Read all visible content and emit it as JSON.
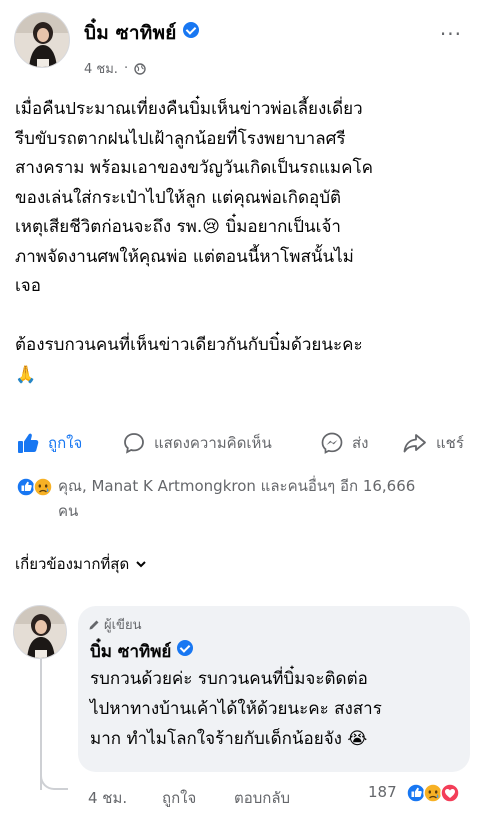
{
  "post": {
    "author": "บิ๋ม ซาทิพย์",
    "time": "4 ชม.",
    "separator": "·",
    "text": "เมื่อคืนประมาณเที่ยงคืนบิ๋มเห็นข่าวพ่อเลี้ยงเดี่ยว\nรีบขับรถตากฝนไปเฝ้าลูกน้อยที่โรงพยาบาลศรี\nสางคราม พร้อมเอาของขวัญวันเกิดเป็นรถแมคโค\nของเล่นใส่กระเป๋าไปให้ลูก แต่คุณพ่อเกิดอุบัติ\nเหตุเสียชีวิตก่อนจะถึง รพ.😢 บิ๋มอยากเป็นเจ้า\nภาพจัดงานศพให้คุณพ่อ แต่ตอนนี้หาโพสนั้นไม่\nเจอ\n\nต้องรบกวนคนที่เห็นข่าวเดียวกันกับบิ๋มด้วยนะคะ\n🙏"
  },
  "actions": {
    "like": "ถูกใจ",
    "comment": "แสดงความคิดเห็น",
    "send": "ส่ง",
    "share": "แชร์"
  },
  "reactions": {
    "summary": "คุณ, Manat K Artmongkron และคนอื่นๆ อีก 16,666\nคน",
    "types": [
      "like",
      "sad"
    ]
  },
  "comments": {
    "sort_label": "เกี่ยวข้องมากที่สุด",
    "items": [
      {
        "badge": "ผู้เขียน",
        "author": "บิ๋ม ซาทิพย์",
        "text": "รบกวนด้วยค่ะ รบกวนคนที่บิ๋มจะติดต่อ\nไปหาทางบ้านเค้าได้ให้ด้วยนะคะ สงสาร\nมาก ทำไมโลกใจร้ายกับเด็กน้อยจัง 😭",
        "time": "4 ชม.",
        "like_label": "ถูกใจ",
        "reply_label": "ตอบกลับ",
        "reaction_count": "187",
        "reaction_types": [
          "like",
          "sad",
          "love"
        ]
      }
    ]
  },
  "icons": {
    "more": "more-icon",
    "globe": "globe-icon",
    "like": "thumbs-up-icon",
    "comment": "comment-icon",
    "send": "messenger-icon",
    "share": "share-icon",
    "sort": "chevron-down-icon",
    "author_badge": "pencil-icon",
    "verified": "verified-badge-icon"
  },
  "colors": {
    "accent": "#1877f2",
    "secondary_text": "#65676b",
    "bubble_bg": "#f0f2f5",
    "sad_reaction": "#f7b125",
    "love_reaction": "#f33e58"
  }
}
